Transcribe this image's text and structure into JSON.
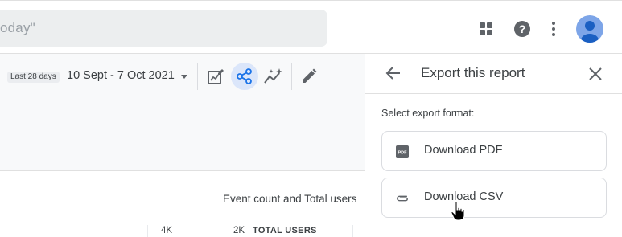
{
  "header": {
    "search_text": "oday\"",
    "icons": [
      "apps-icon",
      "help-icon",
      "more-vert-icon",
      "account-avatar"
    ]
  },
  "report": {
    "range_chip": "Last 28 days",
    "date_range": "10 Sept - 7 Oct 2021",
    "chart_title": "Event count and Total users",
    "axis_left_tick": "4K",
    "axis_right_tick": "2K",
    "legend_label": "TOTAL USERS",
    "tools": [
      "edit-report-icon",
      "share-icon",
      "insights-icon",
      "pencil-icon"
    ]
  },
  "export_panel": {
    "title": "Export this report",
    "format_label": "Select export format:",
    "options": [
      {
        "label": "Download PDF",
        "icon": "pdf-icon"
      },
      {
        "label": "Download CSV",
        "icon": "attachment-icon"
      }
    ]
  },
  "colors": {
    "share_highlight": "#dbe6fa",
    "accent_blue": "#1a73e8",
    "avatar": "#7da5e8"
  }
}
